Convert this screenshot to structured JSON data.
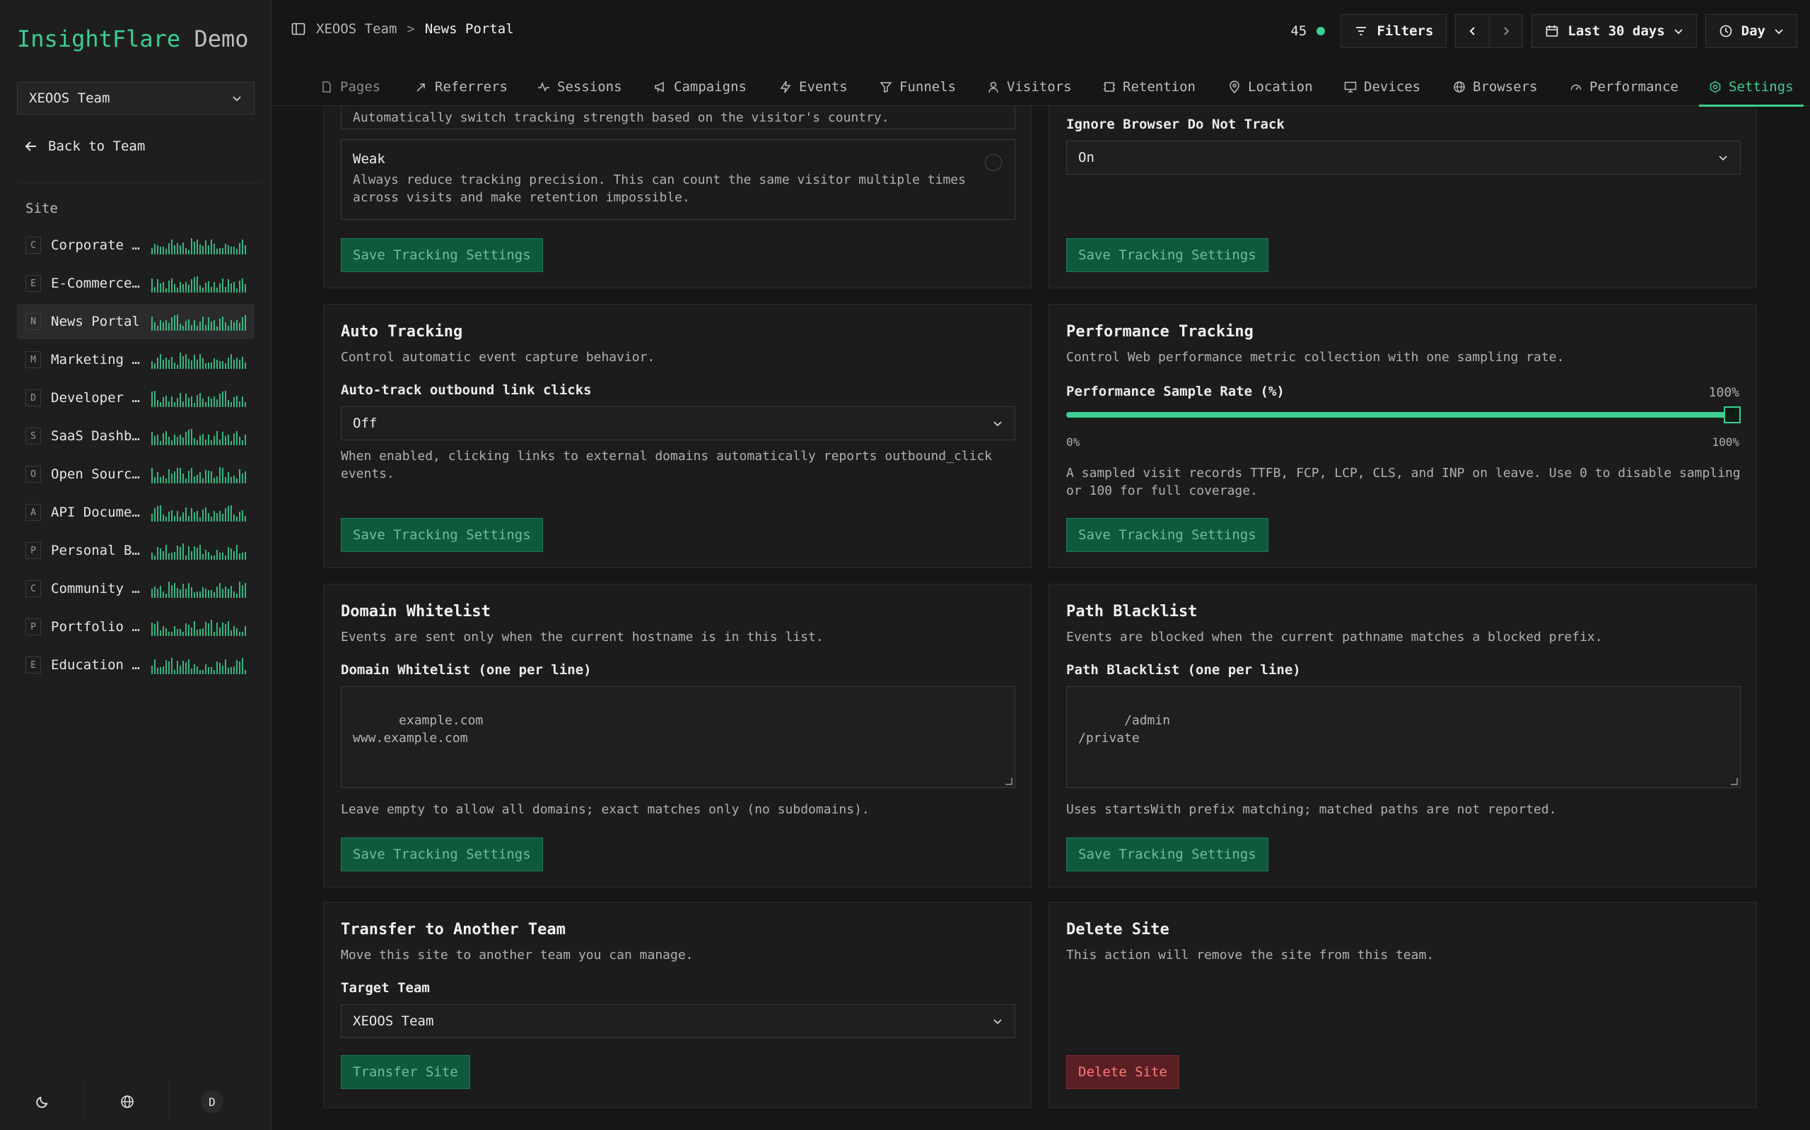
{
  "app": {
    "brand_primary": "InsightFlare",
    "brand_secondary": "Demo",
    "accent": "#3ccf91"
  },
  "sidebar": {
    "team": "XEOOS Team",
    "back_label": "Back to Team",
    "section_label": "Site",
    "sites": [
      {
        "letter": "C",
        "name": "Corporate Website",
        "active": false
      },
      {
        "letter": "E",
        "name": "E-Commerce Store",
        "active": false
      },
      {
        "letter": "N",
        "name": "News Portal",
        "active": true
      },
      {
        "letter": "M",
        "name": "Marketing Landing",
        "active": false
      },
      {
        "letter": "D",
        "name": "Developer Docs",
        "active": false
      },
      {
        "letter": "S",
        "name": "SaaS Dashboard",
        "active": false
      },
      {
        "letter": "O",
        "name": "Open Source Project",
        "active": false
      },
      {
        "letter": "A",
        "name": "API Documentation",
        "active": false
      },
      {
        "letter": "P",
        "name": "Personal Blog",
        "active": false
      },
      {
        "letter": "C",
        "name": "Community Forum",
        "active": false
      },
      {
        "letter": "P",
        "name": "Portfolio Site",
        "active": false
      },
      {
        "letter": "E",
        "name": "Education Platform",
        "active": false
      }
    ],
    "footer": {
      "theme_icon": "moon-icon",
      "lang_icon": "globe-icon",
      "avatar_initial": "D"
    }
  },
  "topbar": {
    "breadcrumb_team": "XEOOS Team",
    "breadcrumb_separator": ">",
    "breadcrumb_page": "News Portal",
    "online_count": "45",
    "filters_label": "Filters",
    "range_label": "Last 30 days",
    "interval_label": "Day"
  },
  "tabs": [
    {
      "label": "Pages",
      "icon": "file-icon"
    },
    {
      "label": "Referrers",
      "icon": "share-icon"
    },
    {
      "label": "Sessions",
      "icon": "activity-icon"
    },
    {
      "label": "Campaigns",
      "icon": "megaphone-icon"
    },
    {
      "label": "Events",
      "icon": "bolt-icon"
    },
    {
      "label": "Funnels",
      "icon": "funnel-icon"
    },
    {
      "label": "Visitors",
      "icon": "user-icon"
    },
    {
      "label": "Retention",
      "icon": "retention-icon"
    },
    {
      "label": "Location",
      "icon": "pin-icon"
    },
    {
      "label": "Devices",
      "icon": "monitor-icon"
    },
    {
      "label": "Browsers",
      "icon": "globe-icon"
    },
    {
      "label": "Performance",
      "icon": "gauge-icon"
    },
    {
      "label": "Settings",
      "icon": "settings-icon"
    }
  ],
  "settings": {
    "save_label": "Save Tracking Settings",
    "tracking_strength": {
      "prev_option_desc": "Automatically switch tracking strength based on the visitor's country.",
      "weak_title": "Weak",
      "weak_desc": "Always reduce tracking precision. This can count the same visitor multiple times across visits and make retention impossible."
    },
    "dnt": {
      "label": "Ignore Browser Do Not Track",
      "value": "On"
    },
    "auto_tracking": {
      "title": "Auto Tracking",
      "desc": "Control automatic event capture behavior.",
      "field_label": "Auto-track outbound link clicks",
      "value": "Off",
      "help": "When enabled, clicking links to external domains automatically reports outbound_click events."
    },
    "performance": {
      "title": "Performance Tracking",
      "desc": "Control Web performance metric collection with one sampling rate.",
      "field_label": "Performance Sample Rate (%)",
      "value_label": "100%",
      "value": 100,
      "min_label": "0%",
      "max_label": "100%",
      "help": "A sampled visit records TTFB, FCP, LCP, CLS, and INP on leave. Use 0 to disable sampling or 100 for full coverage."
    },
    "domain_whitelist": {
      "title": "Domain Whitelist",
      "desc": "Events are sent only when the current hostname is in this list.",
      "field_label": "Domain Whitelist (one per line)",
      "value": "example.com\nwww.example.com",
      "help": "Leave empty to allow all domains; exact matches only (no subdomains)."
    },
    "path_blacklist": {
      "title": "Path Blacklist",
      "desc": "Events are blocked when the current pathname matches a blocked prefix.",
      "field_label": "Path Blacklist (one per line)",
      "value": "/admin\n/private",
      "help": "Uses startsWith prefix matching; matched paths are not reported."
    },
    "transfer": {
      "title": "Transfer to Another Team",
      "desc": "Move this site to another team you can manage.",
      "field_label": "Target Team",
      "value": "XEOOS Team",
      "button": "Transfer Site"
    },
    "delete": {
      "title": "Delete Site",
      "desc": "This action will remove the site from this team.",
      "button": "Delete Site"
    }
  }
}
